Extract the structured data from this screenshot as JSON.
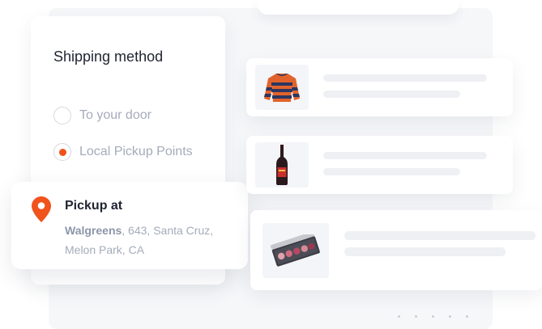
{
  "shipping": {
    "title": "Shipping method",
    "options": [
      {
        "label": "To your door",
        "selected": false
      },
      {
        "label": "Local Pickup Points",
        "selected": true
      }
    ]
  },
  "pickup": {
    "heading": "Pickup at",
    "store": "Walgreens",
    "address_rest": ", 643, Santa Cruz, Melon Park, CA"
  },
  "products": [
    {
      "icon": "sweater-icon"
    },
    {
      "icon": "wine-bottle-icon"
    },
    {
      "icon": "makeup-palette-icon"
    }
  ],
  "colors": {
    "accent": "#f0531c",
    "text": "#1f2430",
    "muted": "#a4acba"
  }
}
